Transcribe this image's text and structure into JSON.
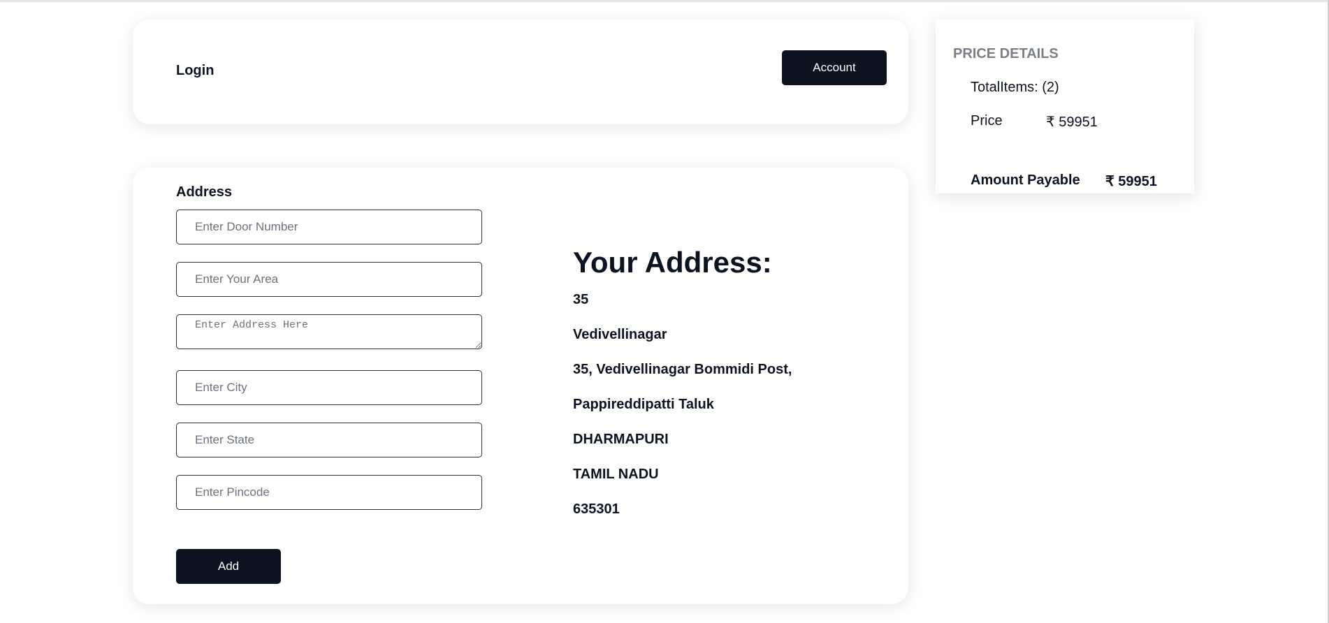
{
  "header": {
    "login_label": "Login",
    "account_label": "Account"
  },
  "address_form": {
    "section_label": "Address",
    "fields": {
      "door": {
        "placeholder": "Enter Door Number",
        "value": ""
      },
      "area": {
        "placeholder": "Enter Your Area",
        "value": ""
      },
      "address": {
        "placeholder": "Enter Address Here",
        "value": ""
      },
      "city": {
        "placeholder": "Enter City",
        "value": ""
      },
      "state": {
        "placeholder": "Enter State",
        "value": ""
      },
      "pincode": {
        "placeholder": "Enter Pincode",
        "value": ""
      }
    },
    "add_label": "Add"
  },
  "your_address": {
    "heading": "Your Address:",
    "lines": [
      "35",
      "Vedivellinagar",
      "35, Vedivellinagar Bommidi Post,",
      "Pappireddipatti Taluk",
      "DHARMAPURI",
      "TAMIL NADU",
      "635301"
    ]
  },
  "price_details": {
    "heading": "PRICE DETAILS",
    "total_items_label": "TotalItems: (2)",
    "price_label": "Price",
    "price_value": "₹ 59951",
    "amount_payable_label": "Amount Payable",
    "amount_payable_value": "₹ 59951"
  },
  "colors": {
    "primary_dark": "#0b1220",
    "muted_heading": "#7a7f86",
    "card_background": "#ffffff"
  }
}
